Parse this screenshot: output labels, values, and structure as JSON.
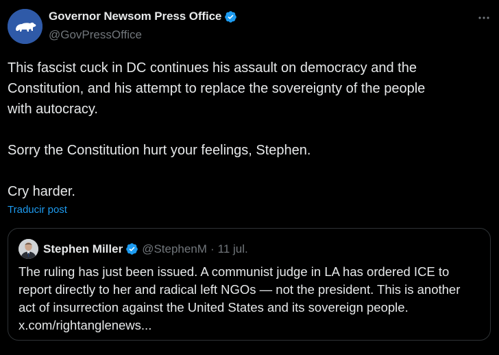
{
  "colors": {
    "background": "#000000",
    "text": "#e7e9ea",
    "muted": "#71767b",
    "accent": "#1d9bf0",
    "border": "#2f3336",
    "verified": "#1d9bf0",
    "avatar": "#2f5aa8"
  },
  "author": {
    "display_name": "Governor Newsom Press Office",
    "handle": "@GovPressOffice",
    "avatar_icon": "california-bear-icon",
    "verified_icon": "verified-badge-icon"
  },
  "post": {
    "more_icon": "more-horizontal-icon",
    "paragraphs": [
      [
        "This fascist cuck in DC continues his assault on democracy and the",
        "Constitution, and his attempt to replace the sovereignty of the people",
        "with autocracy."
      ],
      [
        "Sorry the Constitution hurt your feelings, Stephen."
      ],
      [
        "Cry harder."
      ]
    ],
    "translate_label": "Traducir post"
  },
  "quote": {
    "display_name": "Stephen Miller",
    "handle": "@StephenM",
    "separator": "·",
    "time": "11 jul.",
    "lines": [
      "The ruling has just been issued. A communist judge in LA has ordered ICE to",
      "report directly to her and radical left NGOs — not the president. This is another",
      "act of insurrection against the United States and its sovereign people.",
      "x.com/rightanglenews..."
    ]
  }
}
